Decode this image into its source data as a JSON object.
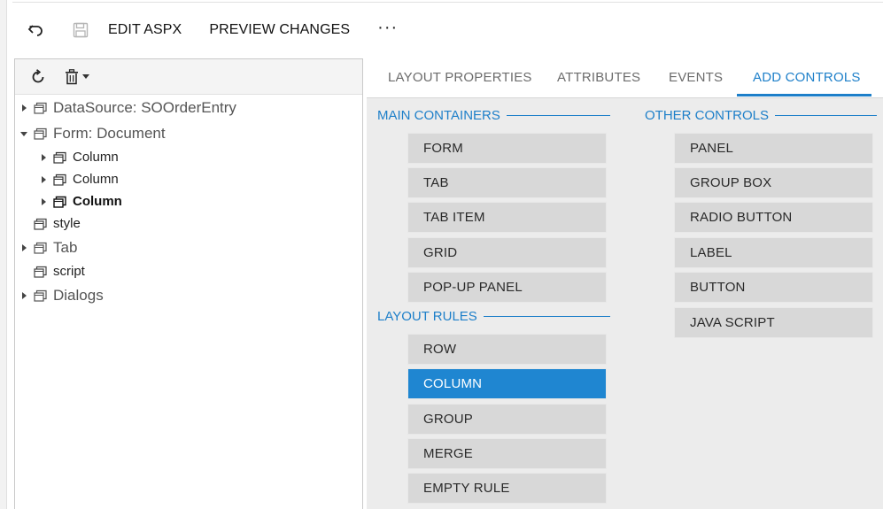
{
  "toolbar": {
    "undo_icon": "undo-icon",
    "save_icon": "save-icon",
    "edit_aspx": "EDIT ASPX",
    "preview_changes": "PREVIEW CHANGES",
    "more": "···"
  },
  "tree_toolbar": {
    "refresh_icon": "refresh-icon",
    "delete_icon": "trash-icon"
  },
  "tree": {
    "datasource": "DataSource: SOOrderEntry",
    "form": "Form: Document",
    "column1": "Column",
    "column2": "Column",
    "column3": "Column",
    "style": "style",
    "tab": "Tab",
    "script": "script",
    "dialogs": "Dialogs"
  },
  "tabs": {
    "layout_properties": "LAYOUT PROPERTIES",
    "attributes": "ATTRIBUTES",
    "events": "EVENTS",
    "add_controls": "ADD CONTROLS",
    "active": "ADD CONTROLS"
  },
  "sections": {
    "main_containers": "MAIN CONTAINERS",
    "layout_rules": "LAYOUT RULES",
    "other_controls": "OTHER CONTROLS"
  },
  "main_containers": [
    "FORM",
    "TAB",
    "TAB ITEM",
    "GRID",
    "POP-UP PANEL"
  ],
  "layout_rules": [
    "ROW",
    "COLUMN",
    "GROUP",
    "MERGE",
    "EMPTY RULE"
  ],
  "other_controls": [
    "PANEL",
    "GROUP BOX",
    "RADIO BUTTON",
    "LABEL",
    "BUTTON",
    "JAVA SCRIPT"
  ],
  "selected_control": "COLUMN",
  "colors": {
    "accent": "#1d7fc9",
    "selected_bg": "#1f86d1",
    "control_bg": "#d8d8d8",
    "panel_bg": "#ececec"
  }
}
